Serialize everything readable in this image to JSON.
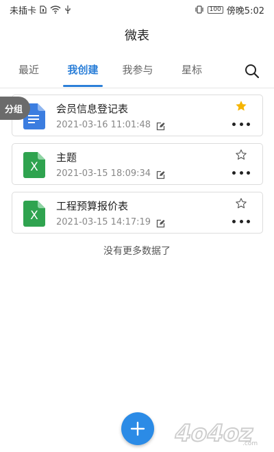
{
  "status_bar": {
    "carrier": "未插卡",
    "battery": "100",
    "time": "傍晚5:02"
  },
  "app": {
    "title": "微表"
  },
  "tabs": [
    {
      "label": "最近",
      "active": false
    },
    {
      "label": "我创建",
      "active": true
    },
    {
      "label": "我参与",
      "active": false
    },
    {
      "label": "星标",
      "active": false
    }
  ],
  "group_tag": "分组",
  "files": [
    {
      "name": "会员信息登记表",
      "date": "2021-03-16 11:01:48",
      "type": "form",
      "starred": true
    },
    {
      "name": "主题",
      "date": "2021-03-15 18:09:34",
      "type": "excel",
      "starred": false
    },
    {
      "name": "工程预算报价表",
      "date": "2021-03-15 14:17:19",
      "type": "excel",
      "starred": false
    }
  ],
  "empty_message": "没有更多数据了",
  "icons": {
    "excel_letter": "X"
  },
  "colors": {
    "accent": "#2b7fd8",
    "excel": "#2fa34f",
    "form": "#3b7de0",
    "star": "#f5b400"
  },
  "watermark": "4o4oz.com"
}
